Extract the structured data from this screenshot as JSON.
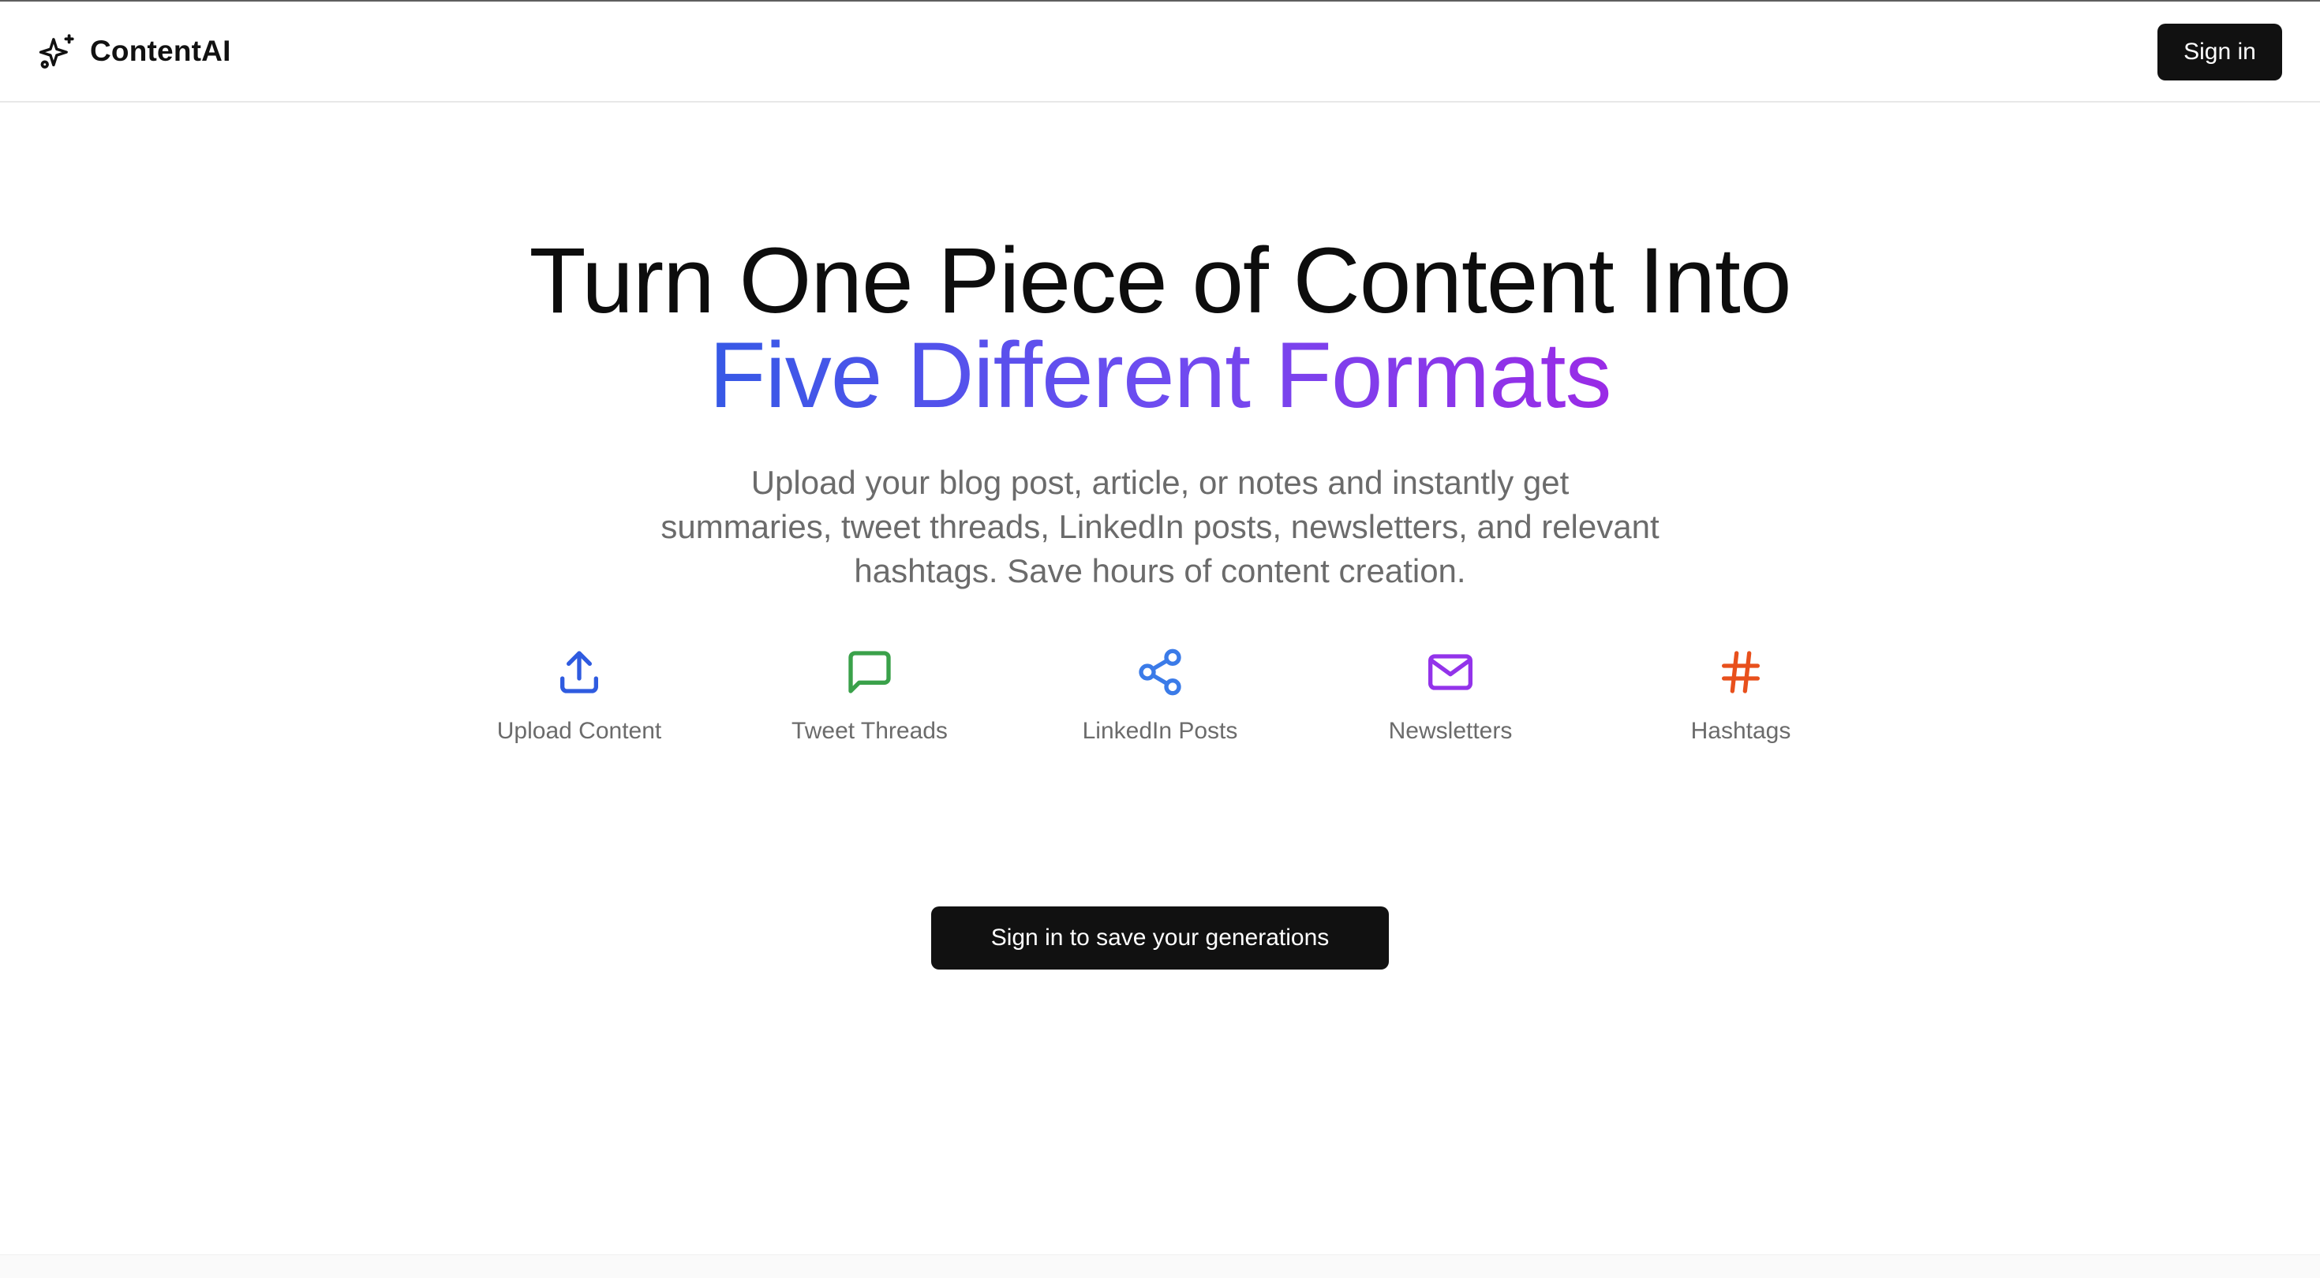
{
  "header": {
    "brand_name": "ContentAI",
    "brand_icon": "sparkles-icon",
    "signin_label": "Sign in"
  },
  "hero": {
    "title_line1": "Turn One Piece of Content Into",
    "title_line2": "Five Different Formats",
    "subtitle_lines": [
      "Upload your blog post, article, or notes and instantly get",
      "summaries, tweet threads, LinkedIn posts, newsletters, and relevant",
      "hashtags. Save hours of content creation."
    ]
  },
  "features": [
    {
      "label": "Upload Content",
      "icon": "upload-icon",
      "color": "#2f5be0"
    },
    {
      "label": "Tweet Threads",
      "icon": "message-square-icon",
      "color": "#3aa14a"
    },
    {
      "label": "LinkedIn Posts",
      "icon": "share-icon",
      "color": "#3b7be8"
    },
    {
      "label": "Newsletters",
      "icon": "mail-icon",
      "color": "#9333ea"
    },
    {
      "label": "Hashtags",
      "icon": "hash-icon",
      "color": "#e8501c"
    }
  ],
  "cta": {
    "label": "Sign in to save your generations"
  },
  "colors": {
    "gradient_start": "#3659e6",
    "gradient_end": "#9a2be6",
    "button_bg": "#111111"
  }
}
